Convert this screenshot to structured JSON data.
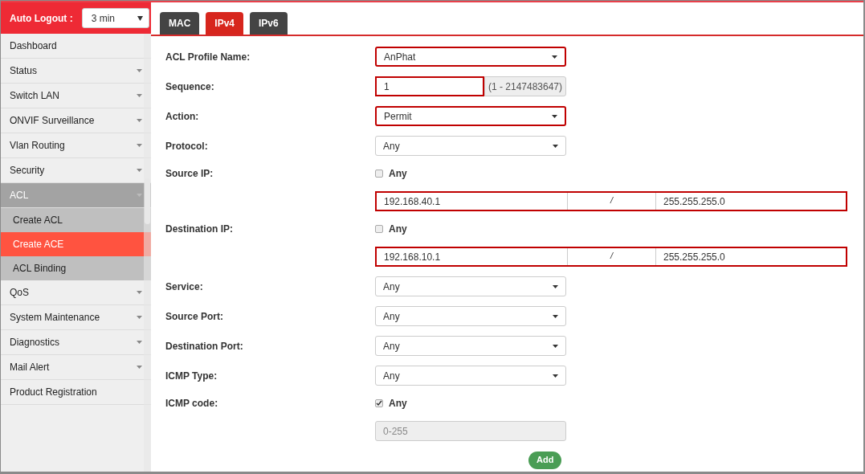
{
  "auto_logout": {
    "label": "Auto Logout :",
    "value": "3 min"
  },
  "sidebar": {
    "items": [
      {
        "label": "Dashboard",
        "expandable": false,
        "expanded": false
      },
      {
        "label": "Status",
        "expandable": true,
        "expanded": false
      },
      {
        "label": "Switch LAN",
        "expandable": true,
        "expanded": false
      },
      {
        "label": "ONVIF Surveillance",
        "expandable": true,
        "expanded": false
      },
      {
        "label": "Vlan Routing",
        "expandable": true,
        "expanded": false
      },
      {
        "label": "Security",
        "expandable": true,
        "expanded": false
      },
      {
        "label": "ACL",
        "expandable": true,
        "expanded": true,
        "children": [
          {
            "label": "Create ACL",
            "selected": false
          },
          {
            "label": "Create ACE",
            "selected": true
          },
          {
            "label": "ACL Binding",
            "selected": false
          }
        ]
      },
      {
        "label": "QoS",
        "expandable": true,
        "expanded": false
      },
      {
        "label": "System Maintenance",
        "expandable": true,
        "expanded": false
      },
      {
        "label": "Diagnostics",
        "expandable": true,
        "expanded": false
      },
      {
        "label": "Mail Alert",
        "expandable": true,
        "expanded": false
      },
      {
        "label": "Product Registration",
        "expandable": false,
        "expanded": false
      }
    ]
  },
  "tabs": [
    {
      "label": "MAC",
      "selected": false
    },
    {
      "label": "IPv4",
      "selected": true
    },
    {
      "label": "IPv6",
      "selected": false
    }
  ],
  "form": {
    "rows": [
      {
        "kind": "select",
        "label": "ACL Profile Name:",
        "value": "AnPhat",
        "highlighted": true
      },
      {
        "kind": "range_input",
        "label": "Sequence:",
        "value": "1",
        "range": "(1 - 2147483647)",
        "highlighted": true
      },
      {
        "kind": "select",
        "label": "Action:",
        "value": "Permit",
        "highlighted": true
      },
      {
        "kind": "select",
        "label": "Protocol:",
        "value": "Any",
        "highlighted": false
      },
      {
        "kind": "checkbox",
        "label": "Source IP:",
        "option": "Any",
        "checked": false
      },
      {
        "kind": "ip_pair",
        "address": "192.168.40.1",
        "separator": "/",
        "mask": "255.255.255.0",
        "highlighted": true
      },
      {
        "kind": "checkbox",
        "label": "Destination IP:",
        "option": "Any",
        "checked": false
      },
      {
        "kind": "ip_pair",
        "address": "192.168.10.1",
        "separator": "/",
        "mask": "255.255.255.0",
        "highlighted": true
      },
      {
        "kind": "select",
        "label": "Service:",
        "value": "Any",
        "highlighted": false
      },
      {
        "kind": "select",
        "label": "Source Port:",
        "value": "Any",
        "highlighted": false
      },
      {
        "kind": "select",
        "label": "Destination Port:",
        "value": "Any",
        "highlighted": false
      },
      {
        "kind": "select",
        "label": "ICMP Type:",
        "value": "Any",
        "highlighted": false
      },
      {
        "kind": "checkbox",
        "label": "ICMP code:",
        "option": "Any",
        "checked": true
      },
      {
        "kind": "disabled_input",
        "placeholder": "0-255"
      },
      {
        "kind": "button",
        "label": "Add"
      }
    ]
  }
}
